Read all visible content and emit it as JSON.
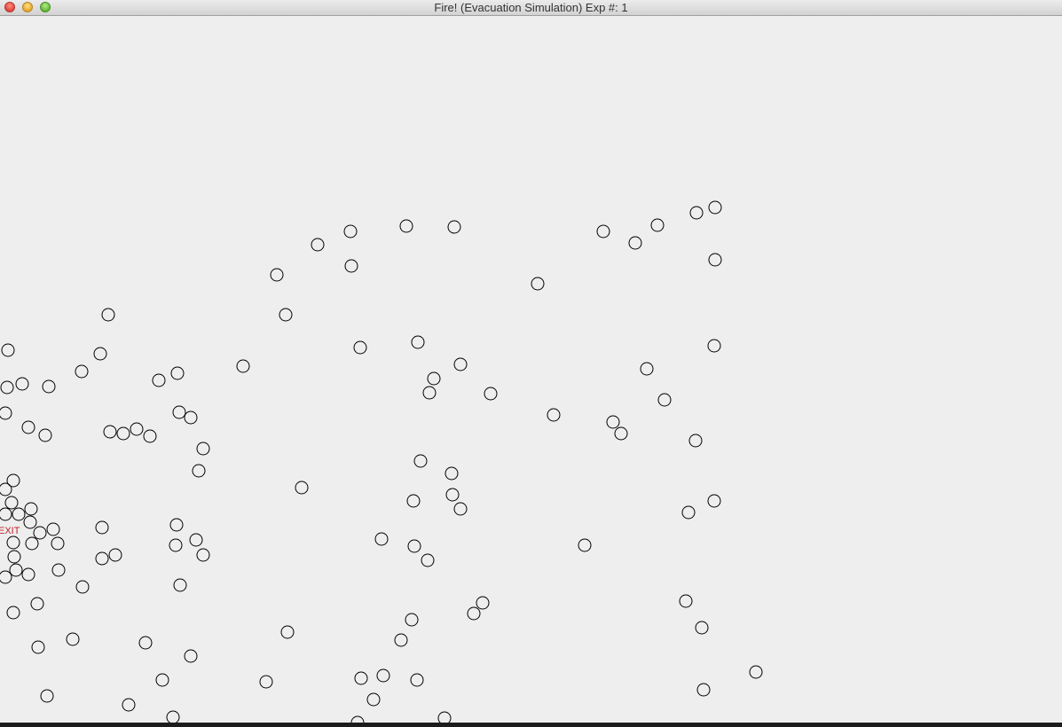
{
  "window": {
    "title": "Fire! (Evacuation Simulation) Exp #: 1"
  },
  "simulation": {
    "exit_label": "EXIT",
    "exit_color": "#c0202a",
    "agent_stroke": "#000000"
  }
}
